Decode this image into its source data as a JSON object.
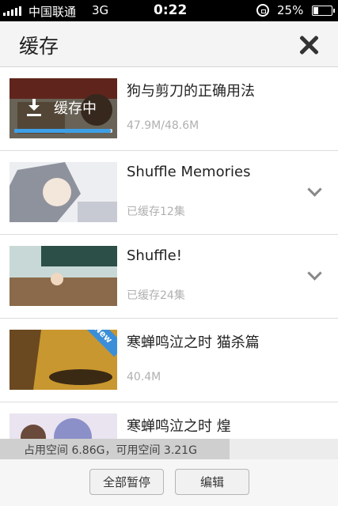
{
  "status_bar": {
    "carrier": "中国联通",
    "network": "3G",
    "time": "0:22",
    "battery": "25%"
  },
  "header": {
    "title": "缓存",
    "close_icon": "close-icon"
  },
  "items": [
    {
      "name": "狗与剪刀的正确用法",
      "meta": "47.9M/48.6M",
      "downloading": true,
      "overlay_label": "缓存中",
      "progress_fraction": 0.985,
      "thumb_colors": [
        "#c84a3a",
        "#e8d7b8",
        "#6a4a3a"
      ]
    },
    {
      "name": "Shuffle  Memories",
      "meta": "已缓存12集",
      "expandable": true,
      "thumb_colors": [
        "#cfcfd6",
        "#8a8f9a",
        "#f0e6dc"
      ]
    },
    {
      "name": "Shuffle!",
      "meta": "已缓存24集",
      "expandable": true,
      "thumb_colors": [
        "#2f5f55",
        "#6f8f8c",
        "#a9c6c3"
      ]
    },
    {
      "name": "寒蝉鸣泣之时 猫杀篇",
      "meta": "40.4M",
      "badge": "New",
      "thumb_colors": [
        "#b8862a",
        "#6e4a1a",
        "#d8a54a"
      ]
    },
    {
      "name": "寒蝉鸣泣之时 煌",
      "meta": "",
      "thumb_colors": [
        "#8c8fc8",
        "#d8c6e0",
        "#f2eef6"
      ]
    }
  ],
  "storage": {
    "text": "占用空间 6.86G，可用空间 3.21G",
    "used_fraction": 0.68
  },
  "footer": {
    "pause_all_label": "全部暂停",
    "edit_label": "编辑"
  }
}
